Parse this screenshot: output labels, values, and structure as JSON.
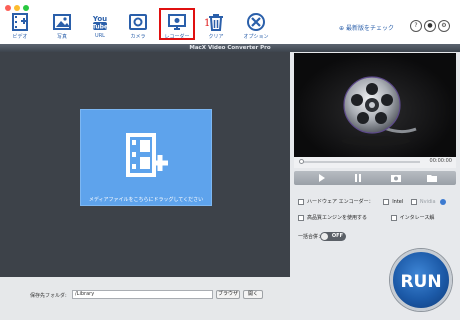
{
  "window": {
    "title": "MacX Video Converter Pro"
  },
  "toolbar": {
    "items": [
      {
        "label": "ビデオ",
        "icon": "add-video-icon"
      },
      {
        "label": "写真",
        "icon": "photo-icon"
      },
      {
        "label": "URL",
        "icon": "youtube-icon"
      },
      {
        "label": "カメラ",
        "icon": "camera-icon"
      },
      {
        "label": "レコーダー",
        "icon": "screen-recorder-icon"
      },
      {
        "label": "クリア",
        "icon": "trash-icon"
      },
      {
        "label": "オプション",
        "icon": "options-icon"
      }
    ],
    "annotation_number": "1",
    "register_link": "最新版をチェック",
    "highlight_color": "#e01010",
    "accent_color": "#2a5faa"
  },
  "drop_zone": {
    "label": "メディアファイルをこちらにドラッグしてください"
  },
  "output": {
    "label": "保存先フォルダ:",
    "path": "/Library",
    "browse_label": "ブラウザ",
    "open_label": "開く"
  },
  "player": {
    "time": "00:00:00"
  },
  "options": {
    "hw_encoder_label": "ハードウェア エンコーダー：",
    "intel_label": "Intel",
    "nvidia_label": "Nvidia",
    "hq_engine_label": "高品質エンジンを使用する",
    "deinterlace_label": "インタレース解",
    "merge_label": "一括合併：",
    "merge_toggle": "OFF"
  },
  "run": {
    "label": "RUN"
  }
}
